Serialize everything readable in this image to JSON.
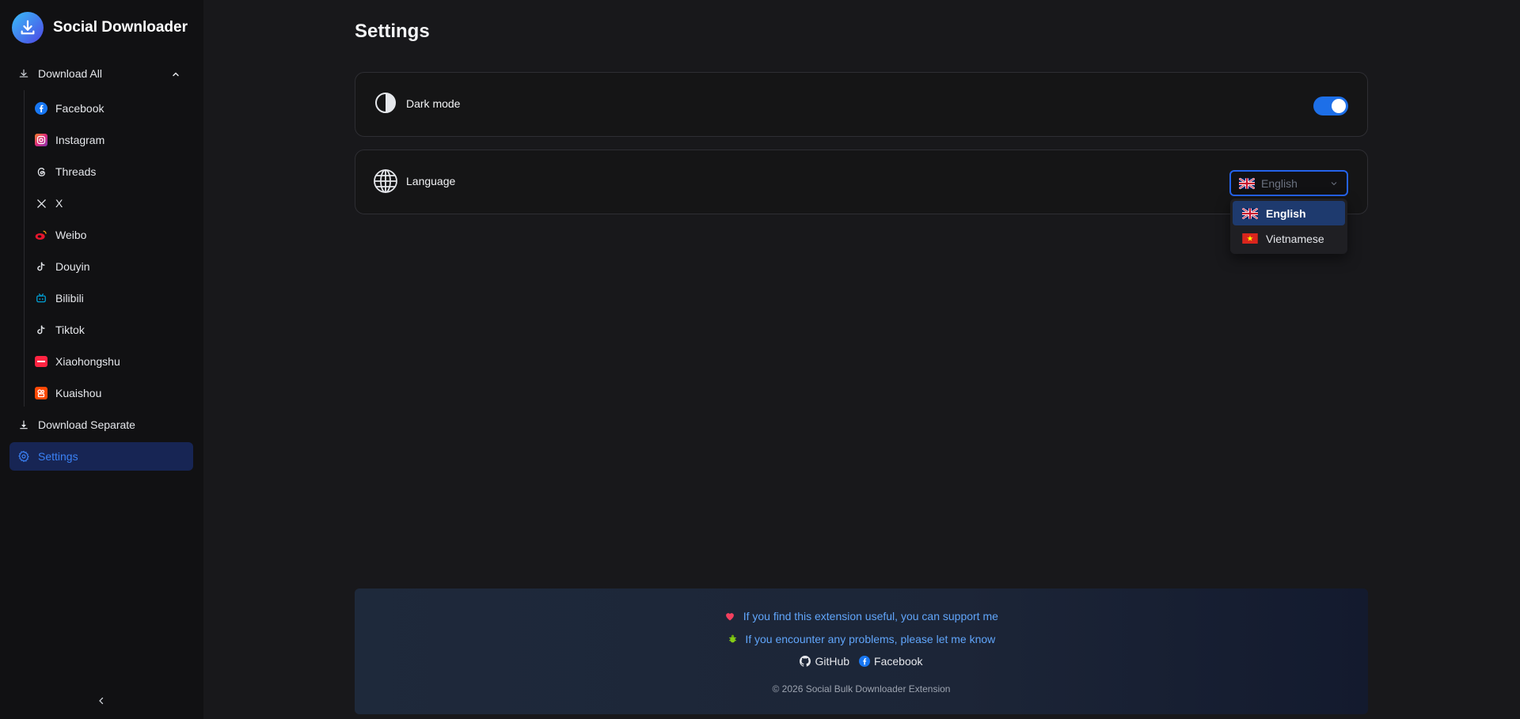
{
  "brand": {
    "title": "Social Downloader"
  },
  "sidebar": {
    "download_all": "Download All",
    "platforms": [
      {
        "label": "Facebook",
        "icon": "facebook-icon",
        "color": "#1877f2"
      },
      {
        "label": "Instagram",
        "icon": "instagram-icon",
        "color": "#e1306c"
      },
      {
        "label": "Threads",
        "icon": "threads-icon",
        "color": "#ffffff"
      },
      {
        "label": "X",
        "icon": "x-icon",
        "color": "#ffffff"
      },
      {
        "label": "Weibo",
        "icon": "weibo-icon",
        "color": "#e6162d"
      },
      {
        "label": "Douyin",
        "icon": "douyin-icon",
        "color": "#ffffff"
      },
      {
        "label": "Bilibili",
        "icon": "bilibili-icon",
        "color": "#00a1d6"
      },
      {
        "label": "Tiktok",
        "icon": "tiktok-icon",
        "color": "#ffffff"
      },
      {
        "label": "Xiaohongshu",
        "icon": "xiaohongshu-icon",
        "color": "#ff2442"
      },
      {
        "label": "Kuaishou",
        "icon": "kuaishou-icon",
        "color": "#ff4906"
      }
    ],
    "download_separate": "Download Separate",
    "settings": "Settings"
  },
  "main": {
    "title": "Settings",
    "dark_mode": {
      "label": "Dark mode",
      "enabled": true
    },
    "language": {
      "label": "Language",
      "selected": "English",
      "options": [
        "English",
        "Vietnamese"
      ]
    }
  },
  "footer": {
    "support": "If you find this extension useful, you can support me",
    "problems": "If you encounter any problems, please let me know",
    "github": "GitHub",
    "facebook": "Facebook",
    "copyright": "© 2026 Social Bulk Downloader Extension"
  },
  "colors": {
    "accent": "#2563eb",
    "active_bg": "#172554",
    "link": "#60a5fa"
  }
}
